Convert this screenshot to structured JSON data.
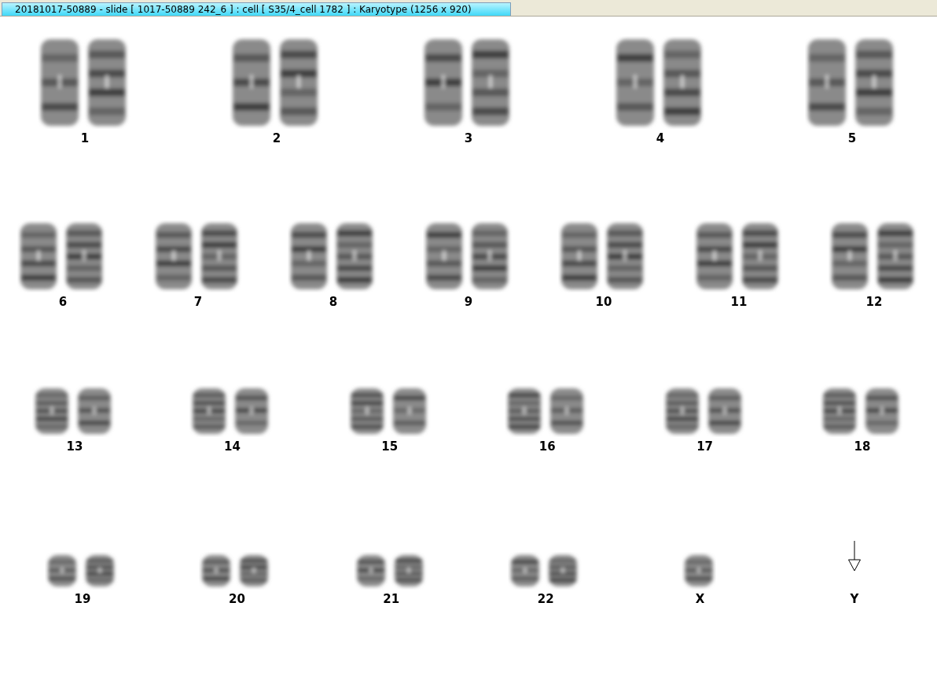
{
  "window": {
    "title": "20181017-50889 - slide [ 1017-50889 242_6 ] : cell [ S35/4_cell 1782 ] : Karyotype  (1256 x 920)"
  },
  "karyotype_rows": [
    {
      "items": [
        {
          "label": "1",
          "kind": "pair"
        },
        {
          "label": "2",
          "kind": "pair"
        },
        {
          "label": "3",
          "kind": "pair"
        },
        {
          "label": "4",
          "kind": "pair"
        },
        {
          "label": "5",
          "kind": "pair"
        }
      ]
    },
    {
      "items": [
        {
          "label": "6",
          "kind": "pair"
        },
        {
          "label": "7",
          "kind": "pair"
        },
        {
          "label": "8",
          "kind": "pair"
        },
        {
          "label": "9",
          "kind": "pair"
        },
        {
          "label": "10",
          "kind": "pair"
        },
        {
          "label": "11",
          "kind": "pair"
        },
        {
          "label": "12",
          "kind": "pair"
        }
      ]
    },
    {
      "items": [
        {
          "label": "13",
          "kind": "pair"
        },
        {
          "label": "14",
          "kind": "pair"
        },
        {
          "label": "15",
          "kind": "pair"
        },
        {
          "label": "16",
          "kind": "pair"
        },
        {
          "label": "17",
          "kind": "pair"
        },
        {
          "label": "18",
          "kind": "pair"
        }
      ]
    },
    {
      "items": [
        {
          "label": "19",
          "kind": "pair"
        },
        {
          "label": "20",
          "kind": "pair"
        },
        {
          "label": "21",
          "kind": "pair"
        },
        {
          "label": "22",
          "kind": "pair"
        },
        {
          "label": "X",
          "kind": "single"
        },
        {
          "label": "Y",
          "kind": "missing"
        }
      ]
    }
  ]
}
